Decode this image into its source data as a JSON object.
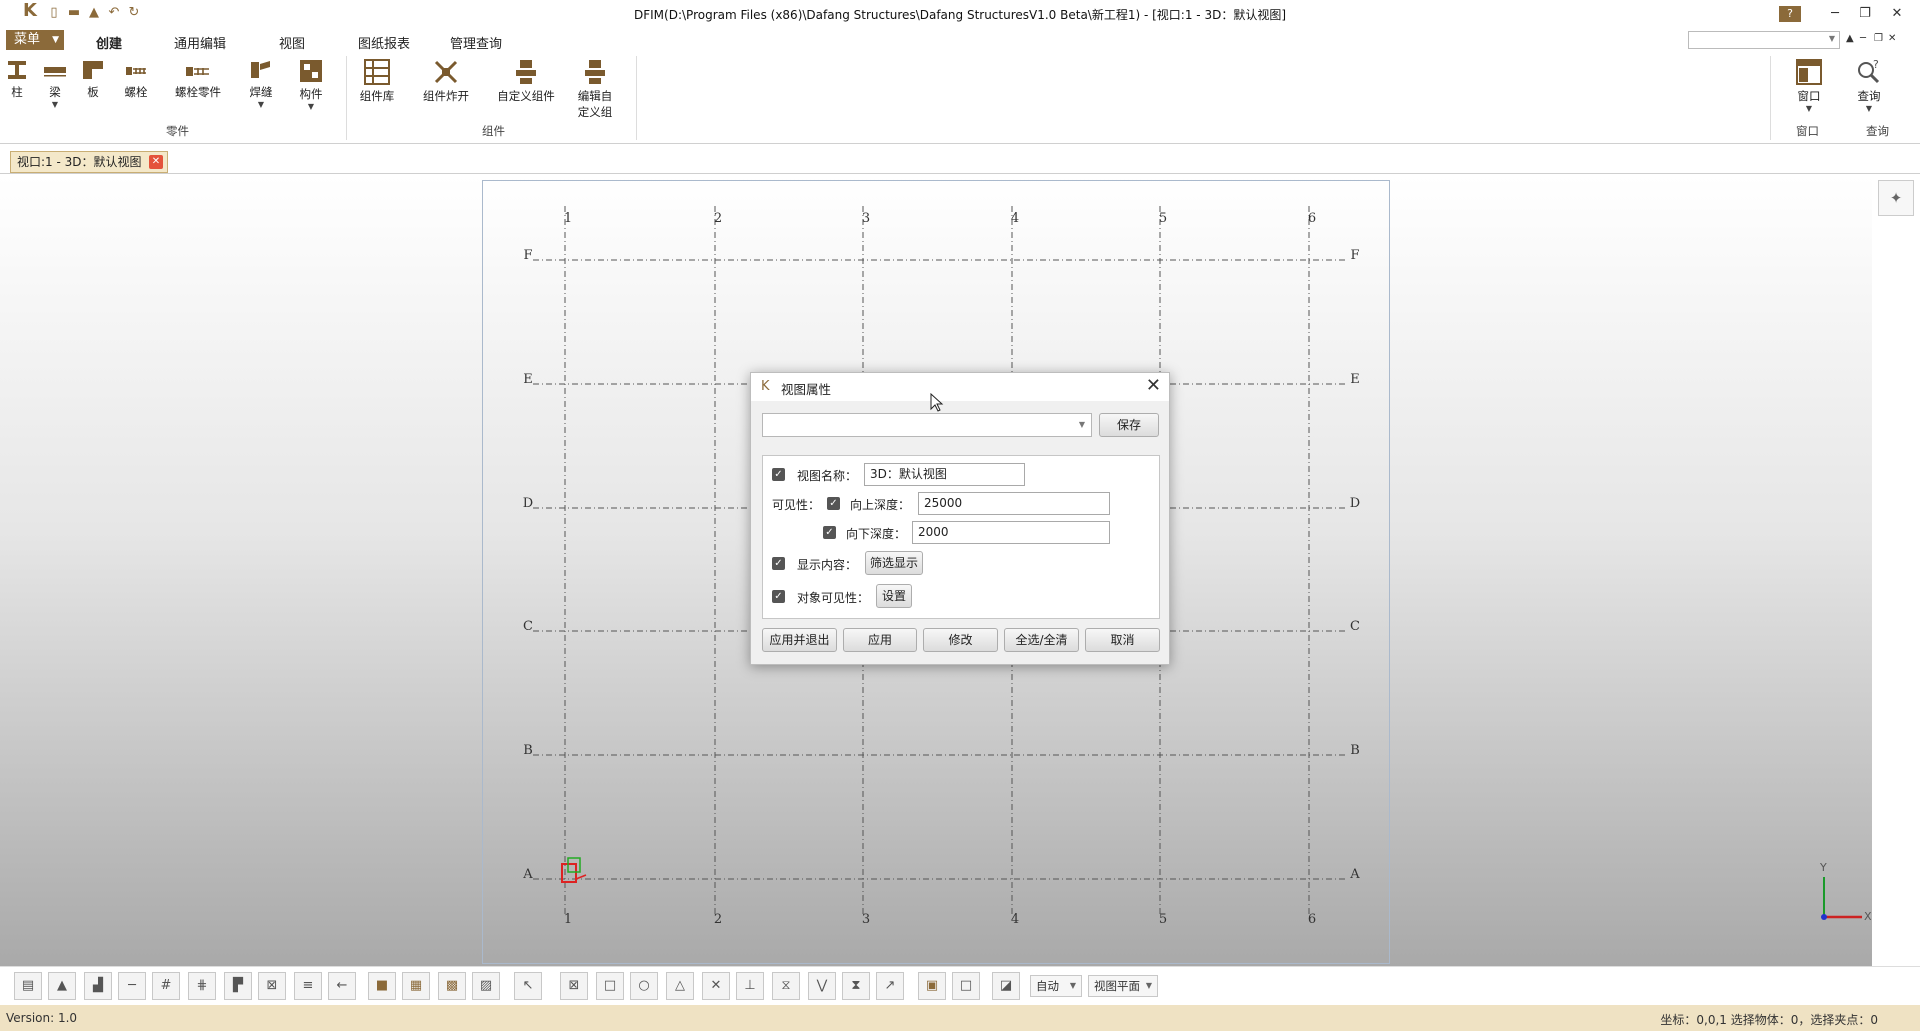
{
  "window": {
    "title": "DFIM(D:\\Program Files (x86)\\Dafang Structures\\Dafang StructuresV1.0 Beta\\新工程1) - [视口:1 - 3D：默认视图]",
    "help_icon": "?",
    "minimize": "─",
    "restore": "❐",
    "close": "✕"
  },
  "menu_button": "菜单",
  "tabs": [
    "创建",
    "通用编辑",
    "视图",
    "图纸报表",
    "管理查询"
  ],
  "ribbon": {
    "parts_group": "零件",
    "components_group": "组件",
    "window_group": "窗口",
    "query_group": "查询",
    "buttons": {
      "column": "柱",
      "beam": "梁",
      "plate": "板",
      "bolt": "螺栓",
      "bolt_part": "螺栓零件",
      "weld": "焊缝",
      "member": "构件",
      "component_lib": "组件库",
      "explode": "组件炸开",
      "custom": "自定义组件",
      "edit_custom_1": "编辑自",
      "edit_custom_2": "定义组",
      "window": "窗口",
      "query": "查询"
    }
  },
  "doc_tab": "视口:1 - 3D：默认视图",
  "grid": {
    "x_labels": [
      "1",
      "2",
      "3",
      "4",
      "5",
      "6"
    ],
    "y_labels": [
      "F",
      "E",
      "D",
      "C",
      "B",
      "A"
    ]
  },
  "axes": {
    "x": "X",
    "y": "Y"
  },
  "dialog": {
    "title": "视图属性",
    "close": "✕",
    "combo_value": "",
    "save": "保存",
    "view_name_label": "视图名称：",
    "view_name_value": "3D：默认视图",
    "visibility_label": "可见性：",
    "up_depth_label": "向上深度：",
    "up_depth_value": "25000",
    "down_depth_label": "向下深度：",
    "down_depth_value": "2000",
    "display_content_label": "显示内容：",
    "filter_display": "筛选显示",
    "object_visibility_label": "对象可见性：",
    "settings": "设置",
    "apply_exit": "应用并退出",
    "apply": "应用",
    "modify": "修改",
    "select_all": "全选/全清",
    "cancel": "取消"
  },
  "bottom_toolbar": {
    "auto": "自动",
    "view_plane": "视图平面"
  },
  "status": {
    "version": "Version: 1.0",
    "right": "坐标：0,0,1    选择物体：0，选择夹点：0"
  }
}
